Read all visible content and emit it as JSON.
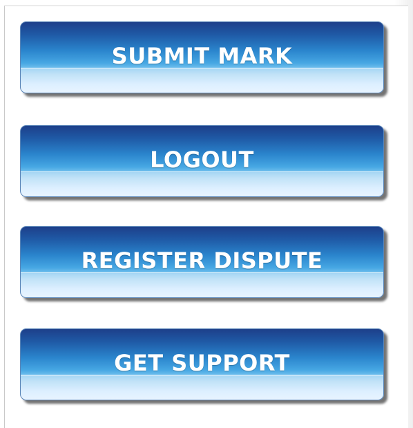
{
  "menu": {
    "buttons": [
      {
        "label": "SUBMIT MARK"
      },
      {
        "label": "LOGOUT"
      },
      {
        "label": "REGISTER DISPUTE"
      },
      {
        "label": "GET SUPPORT"
      }
    ]
  },
  "colors": {
    "button_top": "#1d3f8a",
    "button_mid": "#2a84cc",
    "button_bottom": "#e8f4ff",
    "label": "#ffffff"
  }
}
